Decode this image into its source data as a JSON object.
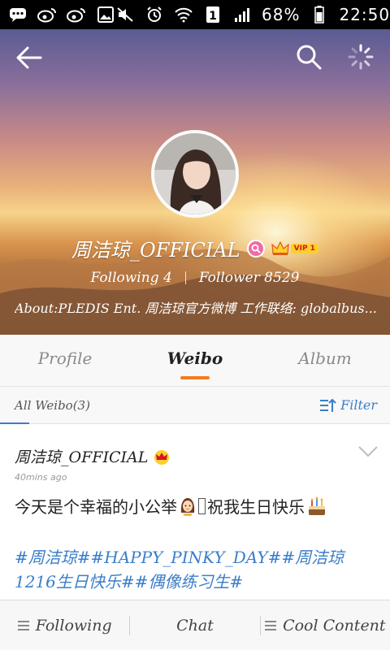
{
  "status_bar": {
    "left_icons": [
      "chat-bubble-icon",
      "weibo-icon",
      "weibo-icon",
      "image-icon"
    ],
    "right_icons": [
      "mute-icon",
      "alarm-icon",
      "wifi-icon",
      "sim-1-icon",
      "signal-icon"
    ],
    "battery": "68%",
    "time": "22:50"
  },
  "profile": {
    "name": "周洁琼_OFFICIAL",
    "vip_label": "VIP 1",
    "following_label": "Following",
    "following_count": "4",
    "follower_label": "Follower",
    "follower_count": "8529",
    "about": "About:PLEDIS Ent. 周洁琼官方微博 工作联络: globalbus..."
  },
  "tabs": [
    {
      "label": "Profile",
      "active": false
    },
    {
      "label": "Weibo",
      "active": true
    },
    {
      "label": "Album",
      "active": false
    }
  ],
  "filter_bar": {
    "all_weibo": "All Weibo(3)",
    "filter_label": "Filter"
  },
  "post": {
    "author": "周洁琼_OFFICIAL",
    "time": "40mins ago",
    "text_part1": "今天是个幸福的小公举",
    "text_part2": "祝我生日快乐",
    "hashtags": "#周洁琼##HAPPY_PINKY_DAY##周洁琼1216生日快乐##偶像练习生#"
  },
  "bottom_nav": {
    "following": "Following",
    "chat": "Chat",
    "cool_content": "Cool Content"
  },
  "colors": {
    "accent_orange": "#f47b20",
    "link_blue": "#3b7ec9",
    "vip_gold": "#ffcf2a"
  }
}
